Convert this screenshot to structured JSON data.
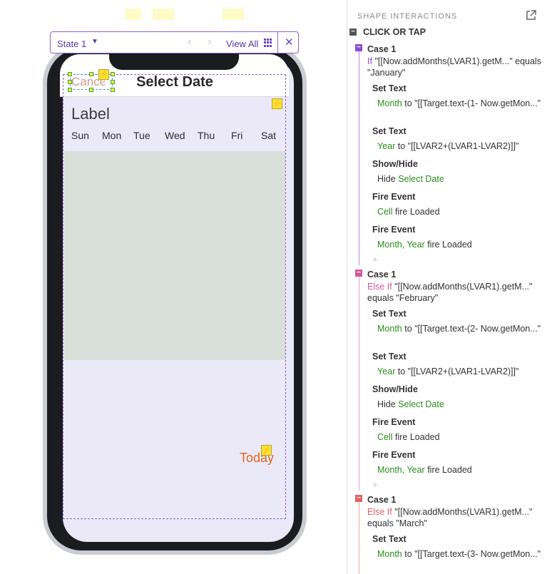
{
  "toolbar": {
    "state_label": "State 1",
    "view_all_label": "View All"
  },
  "screen": {
    "cancel_label": "Cancel",
    "title": "Select Date",
    "label": "Label",
    "weekdays": [
      "Sun",
      "Mon",
      "Tue",
      "Wed",
      "Thu",
      "Fri",
      "Sat"
    ],
    "today_label": "Today"
  },
  "panel": {
    "title": "SHAPE INTERACTIONS",
    "event_label": "CLICK OR TAP",
    "cases": [
      {
        "title": "Case 1",
        "keyword": "If",
        "condition": "\"[[Now.addMonths(LVAR1).getM...\" equals \"January\"",
        "accent": "#8d4bd1",
        "actions": [
          {
            "title": "Set Text",
            "target": "Month",
            "detail": " to \"[[Target.text-(1- Now.getMon...\""
          },
          {
            "title": "Set Text",
            "target": "Year",
            "detail": " to \"[[LVAR2+(LVAR1-LVAR2)]]\""
          },
          {
            "title": "Show/Hide",
            "prefix": "Hide ",
            "target": "Select Date",
            "detail": ""
          },
          {
            "title": "Fire Event",
            "target": "Cell",
            "detail": " fire Loaded"
          },
          {
            "title": "Fire Event",
            "target": "Month, Year",
            "detail": " fire Loaded"
          }
        ]
      },
      {
        "title": "Case 1",
        "keyword": "Else If",
        "condition": "\"[[Now.addMonths(LVAR1).getM...\" equals \"February\"",
        "accent": "#d95799",
        "actions": [
          {
            "title": "Set Text",
            "target": "Month",
            "detail": " to \"[[Target.text-(2- Now.getMon...\""
          },
          {
            "title": "Set Text",
            "target": "Year",
            "detail": " to \"[[LVAR2+(LVAR1-LVAR2)]]\""
          },
          {
            "title": "Show/Hide",
            "prefix": "Hide ",
            "target": "Select Date",
            "detail": ""
          },
          {
            "title": "Fire Event",
            "target": "Cell",
            "detail": " fire Loaded"
          },
          {
            "title": "Fire Event",
            "target": "Month, Year",
            "detail": " fire Loaded"
          }
        ]
      },
      {
        "title": "Case 1",
        "keyword": "Else If",
        "condition": "\"[[Now.addMonths(LVAR1).getM...\" equals \"March\"",
        "accent": "#e06262",
        "actions": [
          {
            "title": "Set Text",
            "target": "Month",
            "detail": " to \"[[Target.text-(3- Now.getMon...\""
          }
        ]
      }
    ]
  },
  "colors": {
    "accent": "#6b43c2",
    "green": "#2c8d1f",
    "today": "#e0651e"
  }
}
